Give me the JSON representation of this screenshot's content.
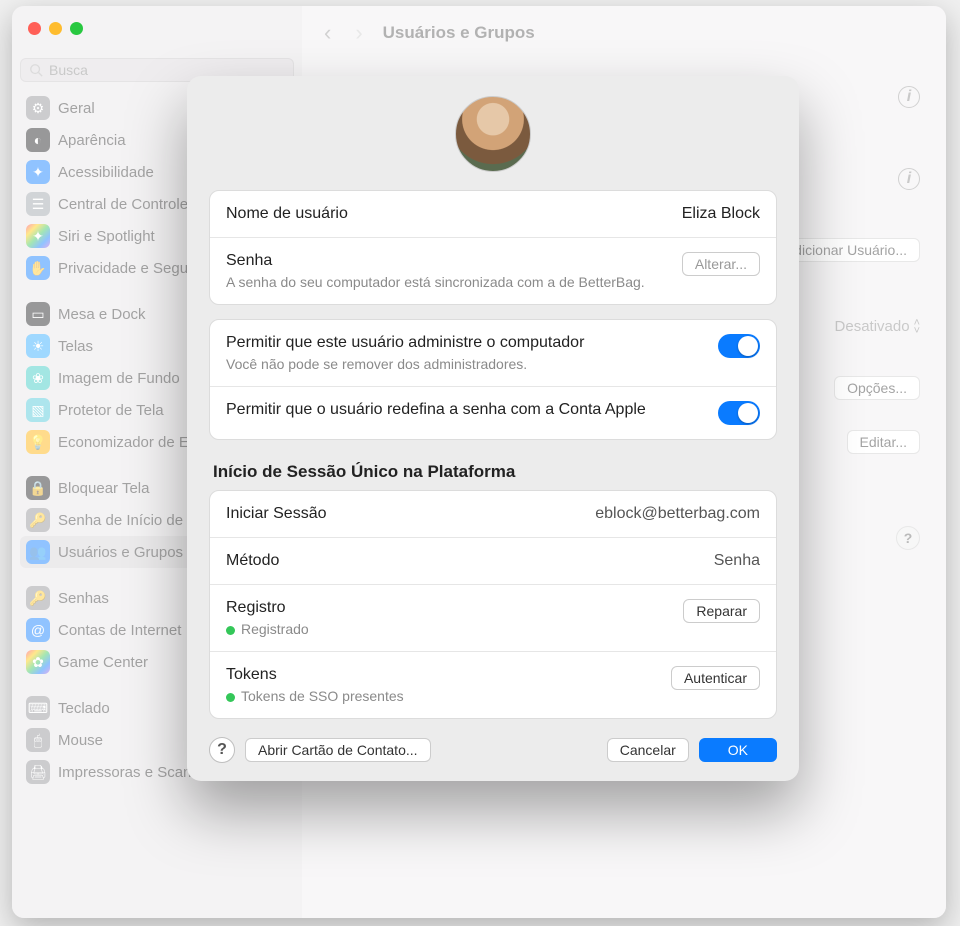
{
  "window": {
    "search_placeholder": "Busca",
    "header": {
      "title": "Usuários e Grupos"
    }
  },
  "sidebar": {
    "items": [
      {
        "label": "Geral",
        "color": "#8e8e93",
        "glyph": "⚙"
      },
      {
        "label": "Aparência",
        "color": "#1c1c1e",
        "glyph": "◐"
      },
      {
        "label": "Acessibilidade",
        "color": "#0a7bff",
        "glyph": "✦"
      },
      {
        "label": "Central de Controle",
        "color": "#9aa0a6",
        "glyph": "☰"
      },
      {
        "label": "Siri e Spotlight",
        "color": "linear",
        "glyph": "✦"
      },
      {
        "label": "Privacidade e Segurança",
        "color": "#0a7bff",
        "glyph": "✋"
      }
    ],
    "group2": [
      {
        "label": "Mesa e Dock",
        "color": "#1c1c1e",
        "glyph": "▭"
      },
      {
        "label": "Telas",
        "color": "#2aa8ff",
        "glyph": "☀"
      },
      {
        "label": "Imagem de Fundo",
        "color": "#34c7c1",
        "glyph": "❀"
      },
      {
        "label": "Protetor de Tela",
        "color": "#4ac6d8",
        "glyph": "▧"
      },
      {
        "label": "Economizador de Energia",
        "color": "#ffb000",
        "glyph": "💡"
      }
    ],
    "group3": [
      {
        "label": "Bloquear Tela",
        "color": "#1c1c1e",
        "glyph": "🔒"
      },
      {
        "label": "Senha de Início de Sessão",
        "color": "#8e8e93",
        "glyph": "🔑"
      },
      {
        "label": "Usuários e Grupos",
        "color": "#0a7bff",
        "glyph": "👥",
        "selected": true
      }
    ],
    "group4": [
      {
        "label": "Senhas",
        "color": "#8e8e93",
        "glyph": "🔑"
      },
      {
        "label": "Contas de Internet",
        "color": "#0a7bff",
        "glyph": "@"
      },
      {
        "label": "Game Center",
        "color": "linear",
        "glyph": "✿"
      }
    ],
    "group5": [
      {
        "label": "Teclado",
        "color": "#8e8e93",
        "glyph": "⌨"
      },
      {
        "label": "Mouse",
        "color": "#8e8e93",
        "glyph": "🖱"
      },
      {
        "label": "Impressoras e Scanners",
        "color": "#8e8e93",
        "glyph": "🖨"
      }
    ]
  },
  "background": {
    "add_user": "Adicionar Usuário...",
    "disabled": "Desativado",
    "options": "Opções...",
    "edit": "Editar..."
  },
  "modal": {
    "username_label": "Nome de usuário",
    "username_value": "Eliza Block",
    "password_label": "Senha",
    "password_sub": "A senha do seu computador está sincronizada com a de BetterBag.",
    "change_btn": "Alterar...",
    "admin_label": "Permitir que este usuário administre o computador",
    "admin_sub": "Você não pode se remover dos administradores.",
    "reset_label": "Permitir que o usuário redefina a senha com a Conta Apple",
    "sso_title": "Início de Sessão Único na Plataforma",
    "login_label": "Iniciar Sessão",
    "login_value": "eblock@betterbag.com",
    "method_label": "Método",
    "method_value": "Senha",
    "register_label": "Registro",
    "register_status": "Registrado",
    "repair_btn": "Reparar",
    "tokens_label": "Tokens",
    "tokens_status": "Tokens de SSO presentes",
    "auth_btn": "Autenticar",
    "open_contact_btn": "Abrir Cartão de Contato...",
    "cancel_btn": "Cancelar",
    "ok_btn": "OK",
    "help": "?"
  }
}
